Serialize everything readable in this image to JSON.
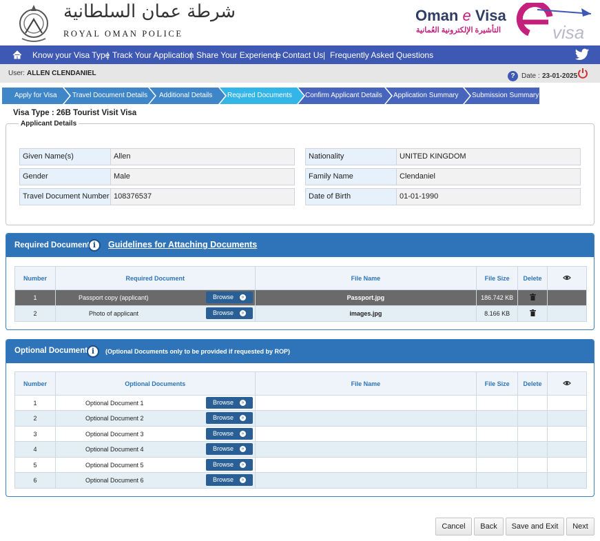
{
  "header": {
    "rop_arabic": "شرطة عمان السلطانية",
    "rop_english": "ROYAL OMAN POLICE",
    "evisa_title_a": "Oman ",
    "evisa_title_e": "e",
    "evisa_title_b": " Visa",
    "evisa_arabic": "التأشيرة الإلكترونية العُمانية",
    "evisa_logo_text": "visa"
  },
  "nav": {
    "items": [
      "Know your Visa Type",
      "Track Your Application",
      "Share Your Experience",
      "Contact Us",
      "Frequently Asked Questions"
    ],
    "separator": "|"
  },
  "userbar": {
    "user_label": "User:",
    "user_name": "ALLEN  CLENDANIEL",
    "help": "?",
    "date_label": "Date :",
    "date_value": "23-01-2025"
  },
  "steps": [
    "Apply for Visa",
    "Travel Document Details",
    "Additional Details",
    "Required Documents",
    "Confirm Applicant Details",
    "Application Summary",
    "Submission Summary"
  ],
  "visa_type": "Visa Type  : 26B Tourist Visit Visa",
  "applicant": {
    "legend": "Applicant Details",
    "given_name_label": "Given Name(s)",
    "given_name": "Allen",
    "gender_label": "Gender",
    "gender": "Male",
    "doc_no_label": "Travel Document Number",
    "doc_no": "108376537",
    "nationality_label": "Nationality",
    "nationality": "UNITED KINGDOM",
    "family_label": "Family Name",
    "family": "Clendaniel",
    "dob_label": "Date of Birth",
    "dob": "01-01-1990"
  },
  "required": {
    "title": "Required Documents",
    "info": "i",
    "guidelines": "Guidelines for Attaching Documents",
    "headers": [
      "Number",
      "Required Document",
      "File Name",
      "File Size",
      "Delete"
    ],
    "rows": [
      {
        "number": "1",
        "document": "Passport copy (applicant)",
        "file": "Passport.jpg",
        "size": "186.742 KB"
      },
      {
        "number": "2",
        "document": "Photo of applicant",
        "file": "images.jpg",
        "size": "8.166 KB"
      }
    ]
  },
  "optional": {
    "title": "Optional Documents",
    "info": "i",
    "note": "(Optional Documents only to be provided if requested by ROP)",
    "headers": [
      "Number",
      "Optional Documents",
      "File Name",
      "File Size",
      "Delete"
    ],
    "rows": [
      {
        "number": "1",
        "document": "Optional Document 1"
      },
      {
        "number": "2",
        "document": "Optional Document 2"
      },
      {
        "number": "3",
        "document": "Optional Document 3"
      },
      {
        "number": "4",
        "document": "Optional Document 4"
      },
      {
        "number": "5",
        "document": "Optional Document 5"
      },
      {
        "number": "6",
        "document": "Optional Document 6"
      }
    ]
  },
  "browse_label": "Browse",
  "browse_arrow": "»",
  "buttons": {
    "cancel": "Cancel",
    "back": "Back",
    "save_exit": "Save and Exit",
    "next": "Next"
  },
  "colors": {
    "nav": "#3e59b4",
    "step_done": "#3f86c8",
    "step_current": "#34b5e8",
    "step_future": "#4765bd",
    "panel": "#2f74b8",
    "brand_pink": "#c4207e"
  },
  "icons": [
    "home-icon",
    "twitter-icon",
    "help-icon",
    "power-icon",
    "info-icon",
    "trash-icon",
    "eye-icon"
  ]
}
